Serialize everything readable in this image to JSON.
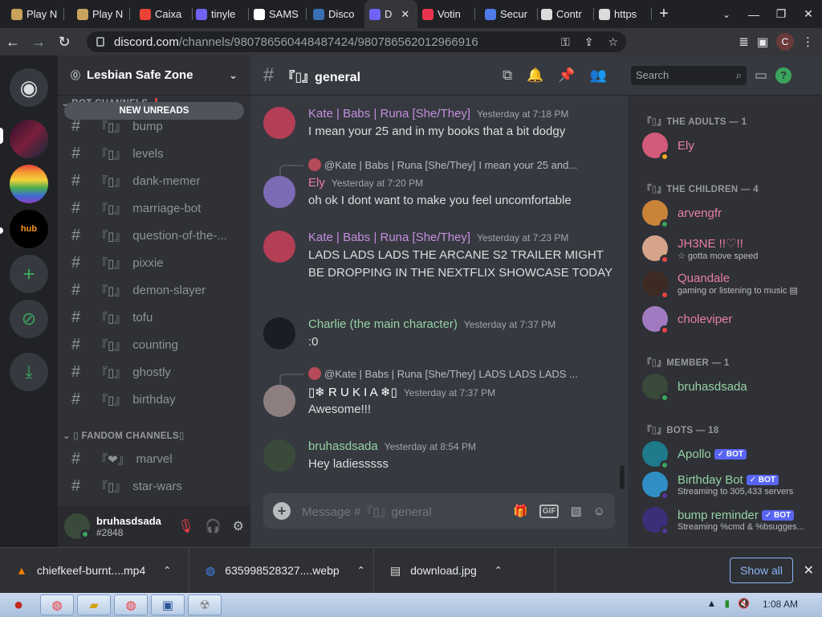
{
  "browser": {
    "tabs": [
      {
        "title": "Play N",
        "icon": "playn-tab-icon",
        "color": "#c9a25c"
      },
      {
        "title": "Play N",
        "icon": "playn-tab-icon",
        "color": "#c9a25c"
      },
      {
        "title": "Caixa",
        "icon": "gmail-icon",
        "color": "#ea4335"
      },
      {
        "title": "tinyle",
        "icon": "tinyle-tab-icon",
        "color": "#6f63f5"
      },
      {
        "title": "SAMS",
        "icon": "google-icon",
        "color": "#ffffff"
      },
      {
        "title": "Disco",
        "icon": "discord-tab-icon",
        "color": "#3a6fb5"
      },
      {
        "title": "D",
        "icon": "discord-tab-icon",
        "color": "#6f63f5"
      },
      {
        "title": "Votin",
        "icon": "votin-tab-icon",
        "color": "#e8344f"
      },
      {
        "title": "Secur",
        "icon": "secure-tab-icon",
        "color": "#4f7be8"
      },
      {
        "title": "Contr",
        "icon": "control-tab-icon",
        "color": "#dcdcdc"
      },
      {
        "title": "https",
        "icon": "globe-icon",
        "color": "#dcdcdc"
      }
    ],
    "active_tab": 6,
    "url_host": "discord.com",
    "url_path": "/channels/980786560448487424/980786562012966916",
    "profile_letter": "C"
  },
  "server": {
    "name": "Lesbian Safe Zone",
    "new_unreads": "NEW UNREADS",
    "categories": [
      {
        "label": "⌄ BOT CHANNELS ❗"
      },
      {
        "label": "⌄ ▯ FANDOM CHANNELS▯"
      }
    ],
    "channels": [
      {
        "prefix": "『▯』",
        "name": "bump"
      },
      {
        "prefix": "『▯』",
        "name": "levels"
      },
      {
        "prefix": "『▯』",
        "name": "dank-memer"
      },
      {
        "prefix": "『▯』",
        "name": "marriage-bot"
      },
      {
        "prefix": "『▯』",
        "name": "question-of-the-..."
      },
      {
        "prefix": "『▯』",
        "name": "pixxie"
      },
      {
        "prefix": "『▯』",
        "name": "demon-slayer"
      },
      {
        "prefix": "『▯』",
        "name": "tofu"
      },
      {
        "prefix": "『▯』",
        "name": "counting"
      },
      {
        "prefix": "『▯』",
        "name": "ghostly"
      },
      {
        "prefix": "『▯』",
        "name": "birthday"
      },
      {
        "prefix": "『❤』",
        "name": "marvel"
      },
      {
        "prefix": "『▯』",
        "name": "star-wars"
      }
    ],
    "user": {
      "name": "bruhasdsada",
      "tag": "#2848"
    }
  },
  "chat": {
    "channel_title": "『▯』general",
    "search_placeholder": "Search",
    "composer_placeholder": "Message #『▯』general",
    "messages": [
      {
        "author": "Kate | Babs | Runa [She/They]",
        "author_color": "#c48fdf",
        "time": "Yesterday at 7:18 PM",
        "body": "I mean your 25 and in my books that a bit dodgy",
        "avatar": "#b33e55"
      },
      {
        "author": "Ely",
        "author_color": "#e87fa8",
        "time": "Yesterday at 7:20 PM",
        "body": "oh ok I dont want to make you feel uncomfortable",
        "avatar": "#7c6bb5",
        "reply_to": "@Kate | Babs | Runa [She/They]",
        "reply_text": "I mean your 25 and..."
      },
      {
        "author": "Kate | Babs | Runa [She/They]",
        "author_color": "#c48fdf",
        "time": "Yesterday at 7:23 PM",
        "body": "LADS LADS LADS THE ARCANE S2 TRAILER MIGHT BE DROPPING IN THE NEXTFLIX SHOWCASE TODAY",
        "avatar": "#b33e55"
      },
      {
        "author": "Charlie (the main character)",
        "author_color": "#96d2a4",
        "time": "Yesterday at 7:37 PM",
        "body": ":0",
        "avatar": "#1a1c26"
      },
      {
        "author": "▯❄ R U K I A ❄▯",
        "author_color": "#ffffff",
        "time": "Yesterday at 7:37 PM",
        "body": "Awesome!!!",
        "avatar": "#8d7e80",
        "reply_to": "@Kate | Babs | Runa [She/They]",
        "reply_text": "LADS LADS LADS ..."
      },
      {
        "author": "bruhasdsada",
        "author_color": "#96d2a4",
        "time": "Yesterday at 8:54 PM",
        "body": "Hey ladiesssss",
        "avatar": "#3a4a3a"
      }
    ]
  },
  "members": {
    "groups": [
      {
        "label": "『▯』THE ADULTS — 1"
      },
      {
        "label": "『▯』THE CHILDREN — 4"
      },
      {
        "label": "『▯』MEMBER — 1"
      },
      {
        "label": "『▯』BOTS — 18"
      }
    ],
    "list": [
      {
        "name": "Ely",
        "color": "#e87fa8",
        "activity": "",
        "status": "#faa61a",
        "avatar": "#d25b7a"
      },
      {
        "name": "arvengfr",
        "color": "#e87fa8",
        "activity": "",
        "status": "#3ba55d",
        "avatar": "#c9843a"
      },
      {
        "name": "JH3NE !!♡!!",
        "color": "#e87fa8",
        "activity": "☆ gotta move speed",
        "status": "#ed4245",
        "avatar": "#d5a48a"
      },
      {
        "name": "Quandale",
        "color": "#e87fa8",
        "activity": "gaming or listening to music ▤",
        "status": "#ed4245",
        "avatar": "#3d2a22"
      },
      {
        "name": "choleviper",
        "color": "#e87fa8",
        "activity": "",
        "status": "#ed4245",
        "avatar": "#a17bc2"
      },
      {
        "name": "bruhasdsada",
        "color": "#96d2a4",
        "activity": "",
        "status": "#3ba55d",
        "avatar": "#3a4a3a"
      },
      {
        "name": "Apollo",
        "color": "#96d2a4",
        "activity": "",
        "status": "#3ba55d",
        "avatar": "#1f7a8c",
        "bot": "✓ BOT"
      },
      {
        "name": "Birthday Bot",
        "color": "#96d2a4",
        "activity": "Streaming to 305,433 servers",
        "status": "#593695",
        "avatar": "#2f8ec4",
        "bot": "✓ BOT"
      },
      {
        "name": "bump reminder",
        "color": "#96d2a4",
        "activity": "Streaming %cmd & %bsugges...",
        "status": "#593695",
        "avatar": "#3b2f7a",
        "bot": "✓ BOT"
      }
    ]
  },
  "downloads": {
    "items": [
      {
        "name": "chiefkeef-burnt....mp4",
        "icon": "vlc-icon"
      },
      {
        "name": "635998528327....webp",
        "icon": "chrome-icon"
      },
      {
        "name": "download.jpg",
        "icon": "image-file-icon"
      }
    ],
    "show_all": "Show all"
  },
  "taskbar": {
    "time": "1:08 AM"
  }
}
